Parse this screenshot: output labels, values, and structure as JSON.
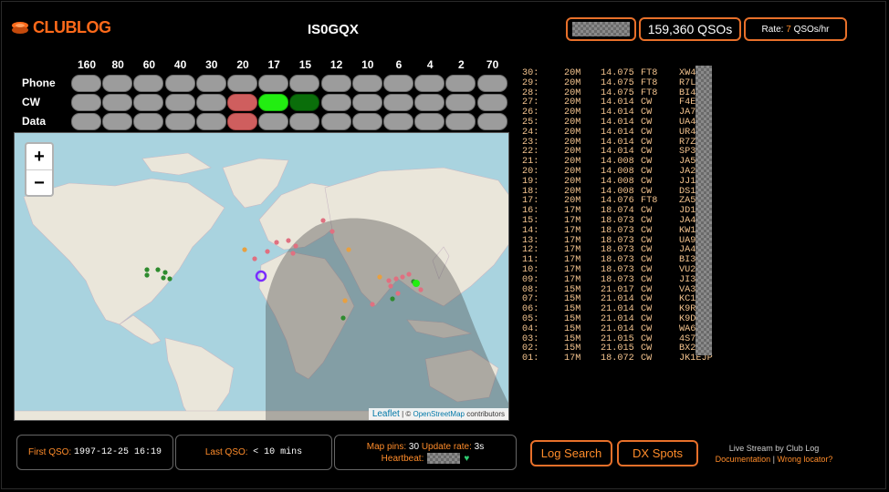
{
  "brand": {
    "name": "CLUBLOG"
  },
  "station": {
    "callsign": "IS0GQX"
  },
  "header": {
    "qso_count": "159,360 QSOs",
    "rate_label": "Rate:",
    "rate_value": "7",
    "rate_unit": "QSOs/hr"
  },
  "bands": [
    "160",
    "80",
    "60",
    "40",
    "30",
    "20",
    "17",
    "15",
    "12",
    "10",
    "6",
    "4",
    "2",
    "70"
  ],
  "modes": [
    "Phone",
    "CW",
    "Data"
  ],
  "band_grid": {
    "Phone": [
      "off",
      "off",
      "off",
      "off",
      "off",
      "off",
      "off",
      "off",
      "off",
      "off",
      "off",
      "off",
      "off",
      "off"
    ],
    "CW": [
      "off",
      "off",
      "off",
      "off",
      "off",
      "red",
      "brightgreen",
      "darkgreen",
      "off",
      "off",
      "off",
      "off",
      "off",
      "off"
    ],
    "Data": [
      "off",
      "off",
      "off",
      "off",
      "off",
      "red",
      "off",
      "off",
      "off",
      "off",
      "off",
      "off",
      "off",
      "off"
    ]
  },
  "map": {
    "zoom_in": "+",
    "zoom_out": "−",
    "attribution_leaflet": "Leaflet",
    "attribution_sep": " | © ",
    "attribution_osm": "OpenStreetMap",
    "attribution_rest": " contributors"
  },
  "log": [
    {
      "n": "30:",
      "band": "20M",
      "freq": "14.075",
      "mode": "FT8",
      "call": "XW4"
    },
    {
      "n": "29:",
      "band": "20M",
      "freq": "14.075",
      "mode": "FT8",
      "call": "R7L"
    },
    {
      "n": "28:",
      "band": "20M",
      "freq": "14.075",
      "mode": "FT8",
      "call": "BI4"
    },
    {
      "n": "27:",
      "band": "20M",
      "freq": "14.014",
      "mode": "CW",
      "call": "F4E"
    },
    {
      "n": "26:",
      "band": "20M",
      "freq": "14.014",
      "mode": "CW",
      "call": "JA7"
    },
    {
      "n": "25:",
      "band": "20M",
      "freq": "14.014",
      "mode": "CW",
      "call": "UA4"
    },
    {
      "n": "24:",
      "band": "20M",
      "freq": "14.014",
      "mode": "CW",
      "call": "UR4"
    },
    {
      "n": "23:",
      "band": "20M",
      "freq": "14.014",
      "mode": "CW",
      "call": "R7Z"
    },
    {
      "n": "22:",
      "band": "20M",
      "freq": "14.014",
      "mode": "CW",
      "call": "SP3"
    },
    {
      "n": "21:",
      "band": "20M",
      "freq": "14.008",
      "mode": "CW",
      "call": "JA5"
    },
    {
      "n": "20:",
      "band": "20M",
      "freq": "14.008",
      "mode": "CW",
      "call": "JA2"
    },
    {
      "n": "19:",
      "band": "20M",
      "freq": "14.008",
      "mode": "CW",
      "call": "JJ1"
    },
    {
      "n": "18:",
      "band": "20M",
      "freq": "14.008",
      "mode": "CW",
      "call": "DS1"
    },
    {
      "n": "17:",
      "band": "20M",
      "freq": "14.076",
      "mode": "FT8",
      "call": "ZA5"
    },
    {
      "n": "16:",
      "band": "17M",
      "freq": "18.074",
      "mode": "CW",
      "call": "JD1"
    },
    {
      "n": "15:",
      "band": "17M",
      "freq": "18.073",
      "mode": "CW",
      "call": "JA4"
    },
    {
      "n": "14:",
      "band": "17M",
      "freq": "18.073",
      "mode": "CW",
      "call": "KW1"
    },
    {
      "n": "13:",
      "band": "17M",
      "freq": "18.073",
      "mode": "CW",
      "call": "UA9"
    },
    {
      "n": "12:",
      "band": "17M",
      "freq": "18.073",
      "mode": "CW",
      "call": "JA4"
    },
    {
      "n": "11:",
      "band": "17M",
      "freq": "18.073",
      "mode": "CW",
      "call": "BI3"
    },
    {
      "n": "10:",
      "band": "17M",
      "freq": "18.073",
      "mode": "CW",
      "call": "VU2"
    },
    {
      "n": "09:",
      "band": "17M",
      "freq": "18.073",
      "mode": "CW",
      "call": "JI3"
    },
    {
      "n": "08:",
      "band": "15M",
      "freq": "21.017",
      "mode": "CW",
      "call": "VA3"
    },
    {
      "n": "07:",
      "band": "15M",
      "freq": "21.014",
      "mode": "CW",
      "call": "KC1"
    },
    {
      "n": "06:",
      "band": "15M",
      "freq": "21.014",
      "mode": "CW",
      "call": "K9R"
    },
    {
      "n": "05:",
      "band": "15M",
      "freq": "21.014",
      "mode": "CW",
      "call": "K9D"
    },
    {
      "n": "04:",
      "band": "15M",
      "freq": "21.014",
      "mode": "CW",
      "call": "WA6"
    },
    {
      "n": "03:",
      "band": "15M",
      "freq": "21.015",
      "mode": "CW",
      "call": "4S7"
    },
    {
      "n": "02:",
      "band": "15M",
      "freq": "21.015",
      "mode": "CW",
      "call": "BX2"
    },
    {
      "n": "01:",
      "band": "17M",
      "freq": "18.072",
      "mode": "CW",
      "call": "JK1EJP"
    }
  ],
  "stats": {
    "first_qso_label": "First QSO:",
    "first_qso_value": "1997-12-25 16:19",
    "last_qso_label": "Last QSO:",
    "last_qso_value": "< 10 mins",
    "map_pins_label": "Map pins:",
    "map_pins_value": "30",
    "update_rate_label": "Update rate:",
    "update_rate_value": "3s",
    "heartbeat_label": "Heartbeat:",
    "heartbeat_icon": "♥"
  },
  "buttons": {
    "log_search": "Log Search",
    "dx_spots": "DX Spots"
  },
  "footer": {
    "line1": "Live Stream by Club Log",
    "documentation": "Documentation",
    "sep": " | ",
    "wrong_locator": "Wrong locator?"
  },
  "colors": {
    "accent": "#e8702a",
    "grid_off": "#9c9c9c",
    "grid_red": "#cf5e5e",
    "grid_bright": "#22ee11",
    "grid_dark": "#0a6e0a",
    "log_text": "#f3c38e"
  }
}
